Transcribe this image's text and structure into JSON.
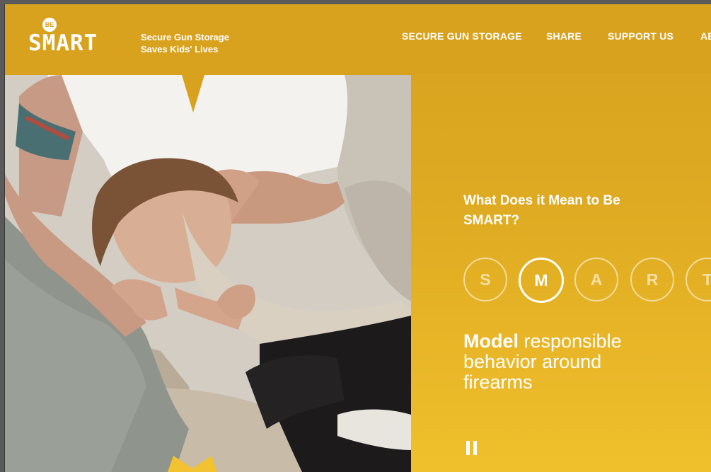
{
  "logo": {
    "badge": "BE",
    "word": "SMART"
  },
  "tagline": {
    "line1": "Secure Gun Storage",
    "line2": "Saves Kids' Lives"
  },
  "nav": {
    "items": [
      {
        "label": "SECURE GUN STORAGE"
      },
      {
        "label": "SHARE"
      },
      {
        "label": "SUPPORT US"
      },
      {
        "label": "AB"
      }
    ]
  },
  "hero": {
    "question": "What Does it Mean to Be SMART?",
    "letters": [
      "S",
      "M",
      "A",
      "R",
      "T"
    ],
    "active_letter": "M",
    "statement_bold": "Model",
    "statement_rest": " responsible behavior around firearms",
    "pause_icon": "pause-icon"
  },
  "colors": {
    "brand_gold": "#d8a21e",
    "gold_light": "#f0c02c",
    "text": "#ffffff"
  }
}
